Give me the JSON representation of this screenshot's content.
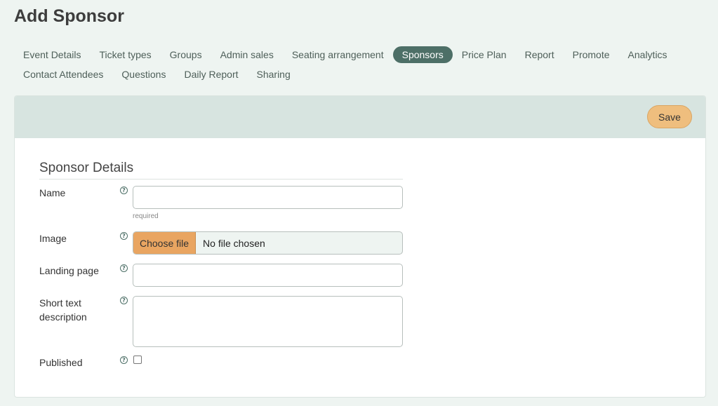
{
  "page": {
    "title": "Add Sponsor"
  },
  "tabs": {
    "row1": [
      "Event Details",
      "Ticket types",
      "Groups",
      "Admin sales",
      "Seating arrangement",
      "Sponsors",
      "Price Plan",
      "Report",
      "Promote",
      "Analytics"
    ],
    "row2": [
      "Contact Attendees",
      "Questions",
      "Daily Report",
      "Sharing"
    ],
    "active": "Sponsors"
  },
  "toolbar": {
    "save_label": "Save"
  },
  "form": {
    "section_title": "Sponsor Details",
    "help_glyph": "?",
    "name": {
      "label": "Name",
      "value": "",
      "hint": "required"
    },
    "image": {
      "label": "Image",
      "button_label": "Choose file",
      "status": "No file chosen"
    },
    "landing_page": {
      "label": "Landing page",
      "value": ""
    },
    "short_text": {
      "label": "Short text description",
      "value": ""
    },
    "published": {
      "label": "Published",
      "checked": false
    }
  },
  "colors": {
    "accent": "#4d6f67",
    "save_button": "#efbe7e",
    "file_button": "#e9a561",
    "background": "#eef4f1",
    "header_band": "#d7e4e0"
  }
}
